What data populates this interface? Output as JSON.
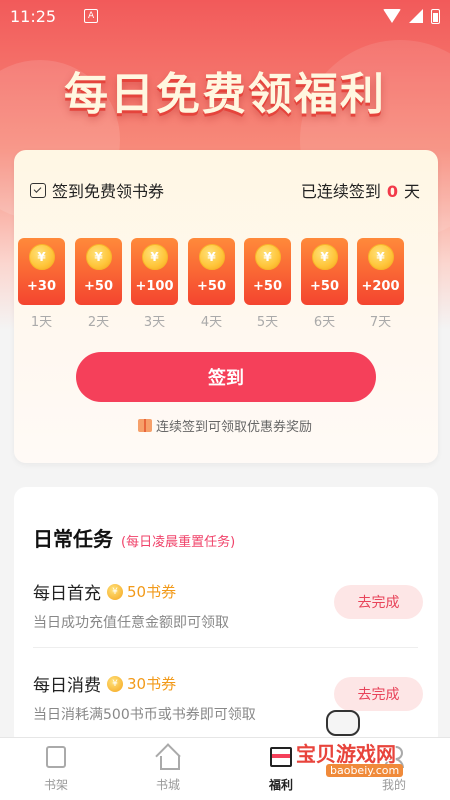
{
  "status_bar": {
    "time": "11:25",
    "notification_icon": "A"
  },
  "banner": {
    "title": "每日免费领福利"
  },
  "sign_in": {
    "title": "签到免费领书券",
    "streak_prefix": "已连续签到",
    "streak_days": "0",
    "streak_suffix": "天",
    "days": [
      {
        "amount": "+30",
        "label": "1天"
      },
      {
        "amount": "+50",
        "label": "2天"
      },
      {
        "amount": "+100",
        "label": "3天"
      },
      {
        "amount": "+50",
        "label": "4天"
      },
      {
        "amount": "+50",
        "label": "5天"
      },
      {
        "amount": "+50",
        "label": "6天"
      },
      {
        "amount": "+200",
        "label": "7天"
      }
    ],
    "coin_symbol": "¥",
    "button_label": "签到",
    "tip": "连续签到可领取优惠券奖励"
  },
  "tasks": {
    "title": "日常任务",
    "subtitle": "(每日凌晨重置任务)",
    "items": [
      {
        "name": "每日首充",
        "reward": "50书券",
        "desc": "当日成功充值任意金额即可领取",
        "button": "去完成"
      },
      {
        "name": "每日消费",
        "reward": "30书券",
        "desc": "当日消耗满500书币或书券即可领取",
        "button": "去完成"
      }
    ]
  },
  "tabbar": {
    "items": [
      {
        "label": "书架",
        "icon": "bookshelf-icon"
      },
      {
        "label": "书城",
        "icon": "home-icon"
      },
      {
        "label": "福利",
        "icon": "gift-icon",
        "active": true
      },
      {
        "label": "我的",
        "icon": "person-icon"
      }
    ]
  },
  "watermark": {
    "text": "宝贝游戏网",
    "url": "baobeiy.com"
  },
  "colors": {
    "accent": "#f5405a",
    "coin": "#f29a1a",
    "banner": "#f25a5a"
  }
}
